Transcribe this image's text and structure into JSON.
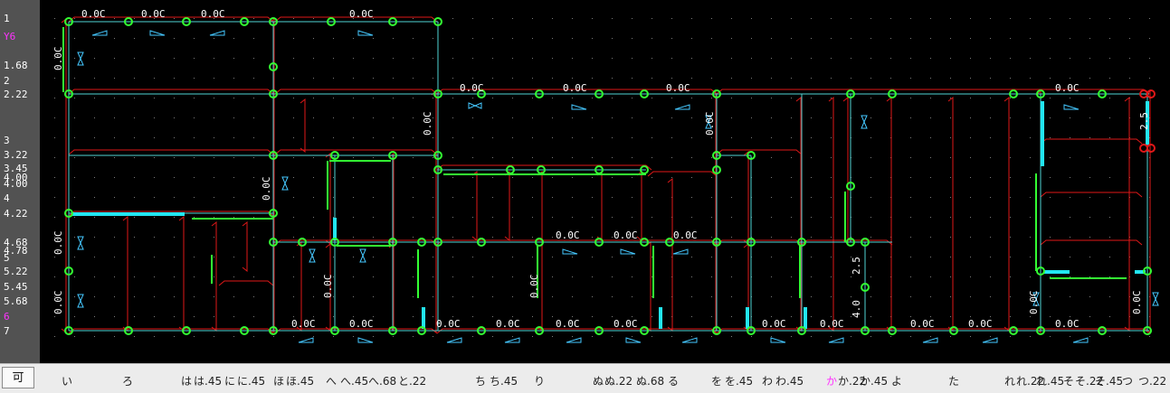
{
  "left_ruler": {
    "labels": [
      "1",
      "Y6",
      "1.68",
      "2",
      "2.22",
      "3",
      "3.22",
      "3.45",
      "4.00",
      "4.00",
      "4",
      "4.22",
      "4.68",
      "4.78",
      "5",
      "5.22",
      "5.45",
      "5.68",
      "6",
      "7"
    ]
  },
  "canvas": {
    "dim_label": "0.0C",
    "short_dim_label": "2.5",
    "short_dim_label_b": "4.0",
    "colors": {
      "background": "#000000",
      "wall": "#e01818",
      "gridline": "#4fd3d3",
      "node": "#33ff33",
      "highlight_segment": "#33ff33",
      "thick_segment": "#22e6f2",
      "marker": "#45c8ff",
      "dot_grid": "#7a7a7a",
      "dim_text": "#ffffff"
    }
  },
  "bottom_bar": {
    "mode_button": "可",
    "axis_labels": [
      "い",
      "ろ",
      "は",
      "は.45",
      "に",
      "に.45",
      "ほ",
      "ほ.45",
      "へ",
      "へ.45",
      "へ.68",
      "と.22",
      "ち",
      "ち.45",
      "り",
      "ぬ",
      "ぬ.22",
      "ぬ.68",
      "る",
      "を",
      "を.45",
      "わ",
      "わ.45",
      "か",
      "か.22",
      "か.45",
      "よ",
      "た",
      "れ",
      "れ.22",
      "れ.45",
      "そ",
      "そ.22",
      "そ.45",
      "つ",
      "つ.22"
    ]
  }
}
